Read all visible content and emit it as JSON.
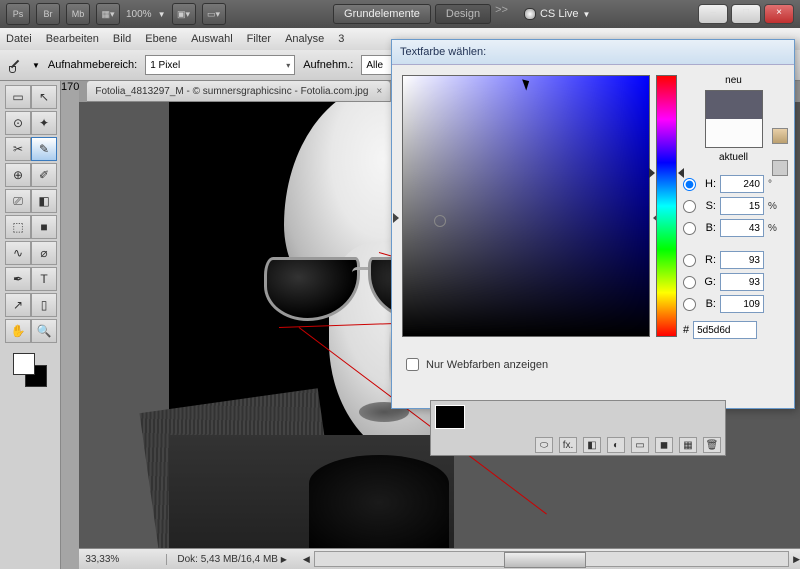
{
  "topbar": {
    "app": "Ps",
    "br": "Br",
    "mb": "Mb",
    "zoom": "100%",
    "ws_active": "Grundelemente",
    "ws_design": "Design",
    "more": ">>",
    "cs_live": "CS Live"
  },
  "win": {
    "min": "–",
    "max": "□",
    "close": "×"
  },
  "menu": [
    "Datei",
    "Bearbeiten",
    "Bild",
    "Ebene",
    "Auswahl",
    "Filter",
    "Analyse",
    "3"
  ],
  "opt": {
    "sample_label": "Aufnahmebereich:",
    "sample_value": "1 Pixel",
    "mode_label": "Aufnehm.:",
    "mode_value": "Alle"
  },
  "doc": {
    "tab": "Fotolia_4813297_M - © sumnersgraphicsinc - Fotolia.com.jpg"
  },
  "status": {
    "zoom": "33,33%",
    "dok_label": "Dok:",
    "dok_val": "5,43 MB/16,4 MB"
  },
  "tools": {
    "icons": [
      "▭",
      "↖",
      "⊙",
      "✦",
      "✂",
      "✎",
      "⊕",
      "✐",
      "⎚",
      "◧",
      "⬚",
      "■",
      "∿",
      "⌀",
      "✒",
      "T",
      "↗",
      "▯",
      "✋",
      "🔍"
    ],
    "active_index": 5
  },
  "picker": {
    "title": "Textfarbe wählen:",
    "neu": "neu",
    "aktuell": "aktuell",
    "H": {
      "val": "240",
      "unit": "°"
    },
    "S": {
      "val": "15",
      "unit": "%"
    },
    "B": {
      "val": "43",
      "unit": "%"
    },
    "R": {
      "val": "93"
    },
    "G": {
      "val": "93"
    },
    "Bc": {
      "val": "109"
    },
    "hex": "5d5d6d",
    "hash": "#",
    "webonly": "Nur Webfarben anzeigen"
  },
  "bottom_icons": [
    "⬭",
    "fx.",
    "◧",
    "◐",
    "▭",
    "◼",
    "▦",
    "🗑"
  ]
}
